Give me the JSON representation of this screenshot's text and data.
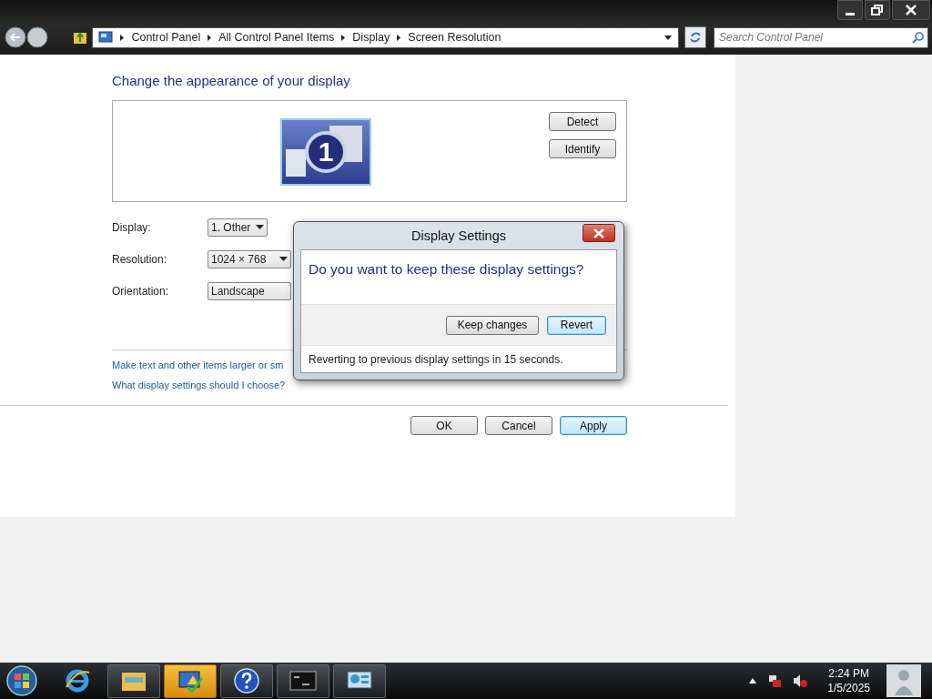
{
  "address_bar": {
    "breadcrumbs": [
      "Control Panel",
      "All Control Panel Items",
      "Display",
      "Screen Resolution"
    ]
  },
  "search": {
    "placeholder": "Search Control Panel"
  },
  "heading": "Change the appearance of your display",
  "preview": {
    "monitor_number": "1",
    "buttons": [
      "Detect",
      "Identify"
    ]
  },
  "fields": [
    {
      "label": "Display:",
      "value": "1. Other"
    },
    {
      "label": "Resolution:",
      "value": "1024 × 768"
    },
    {
      "label": "Orientation:",
      "value": "Landscape"
    }
  ],
  "links": [
    "Make text and other items larger or sm",
    "What display settings should I choose?"
  ],
  "buttons": [
    {
      "label": "OK",
      "default": false
    },
    {
      "label": "Cancel",
      "default": false
    },
    {
      "label": "Apply",
      "default": true
    }
  ],
  "dialog": {
    "title": "Display Settings",
    "question": "Do you want to keep these display settings?",
    "buttons": [
      {
        "label": "Keep changes",
        "default": false
      },
      {
        "label": "Revert",
        "default": true
      }
    ],
    "footer": "Reverting to previous display settings in 15 seconds."
  },
  "taskbar": {
    "apps": [
      {
        "kind": "browser",
        "running": false,
        "highlighted": false
      },
      {
        "kind": "folder",
        "running": true,
        "highlighted": false
      },
      {
        "kind": "control-panel",
        "running": true,
        "highlighted": true
      },
      {
        "kind": "help",
        "running": true,
        "highlighted": false
      },
      {
        "kind": "console",
        "running": true,
        "highlighted": false
      },
      {
        "kind": "display",
        "running": true,
        "highlighted": false
      }
    ],
    "time": "2:24 PM",
    "date": "1/5/2025"
  }
}
